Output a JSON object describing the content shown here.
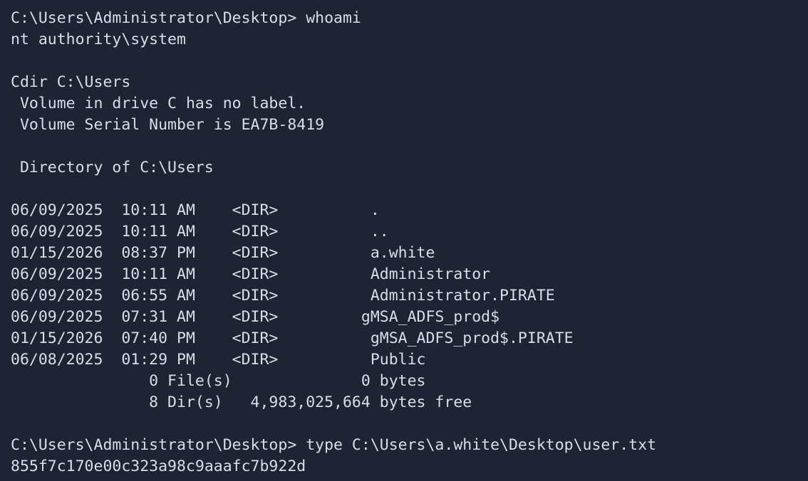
{
  "terminal": {
    "background": "#1e2433",
    "foreground": "#d8dee9",
    "lines": [
      "C:\\Users\\Administrator\\Desktop> whoami",
      "nt authority\\system",
      "",
      "Cdir C:\\Users",
      " Volume in drive C has no label.",
      " Volume Serial Number is EA7B-8419",
      "",
      " Directory of C:\\Users",
      "",
      "06/09/2025  10:11 AM    <DIR>          .",
      "06/09/2025  10:11 AM    <DIR>          ..",
      "01/15/2026  08:37 PM    <DIR>          a.white",
      "06/09/2025  10:11 AM    <DIR>          Administrator",
      "06/09/2025  06:55 AM    <DIR>          Administrator.PIRATE",
      "06/09/2025  07:31 AM    <DIR>         gMSA_ADFS_prod$",
      "01/15/2026  07:40 PM    <DIR>          gMSA_ADFS_prod$.PIRATE",
      "06/08/2025  01:29 PM    <DIR>          Public",
      "               0 File(s)              0 bytes",
      "               8 Dir(s)   4,983,025,664 bytes free",
      "",
      "C:\\Users\\Administrator\\Desktop> type C:\\Users\\a.white\\Desktop\\user.txt",
      "855f7c170e00c323a98c9aaafc7b922d"
    ]
  }
}
